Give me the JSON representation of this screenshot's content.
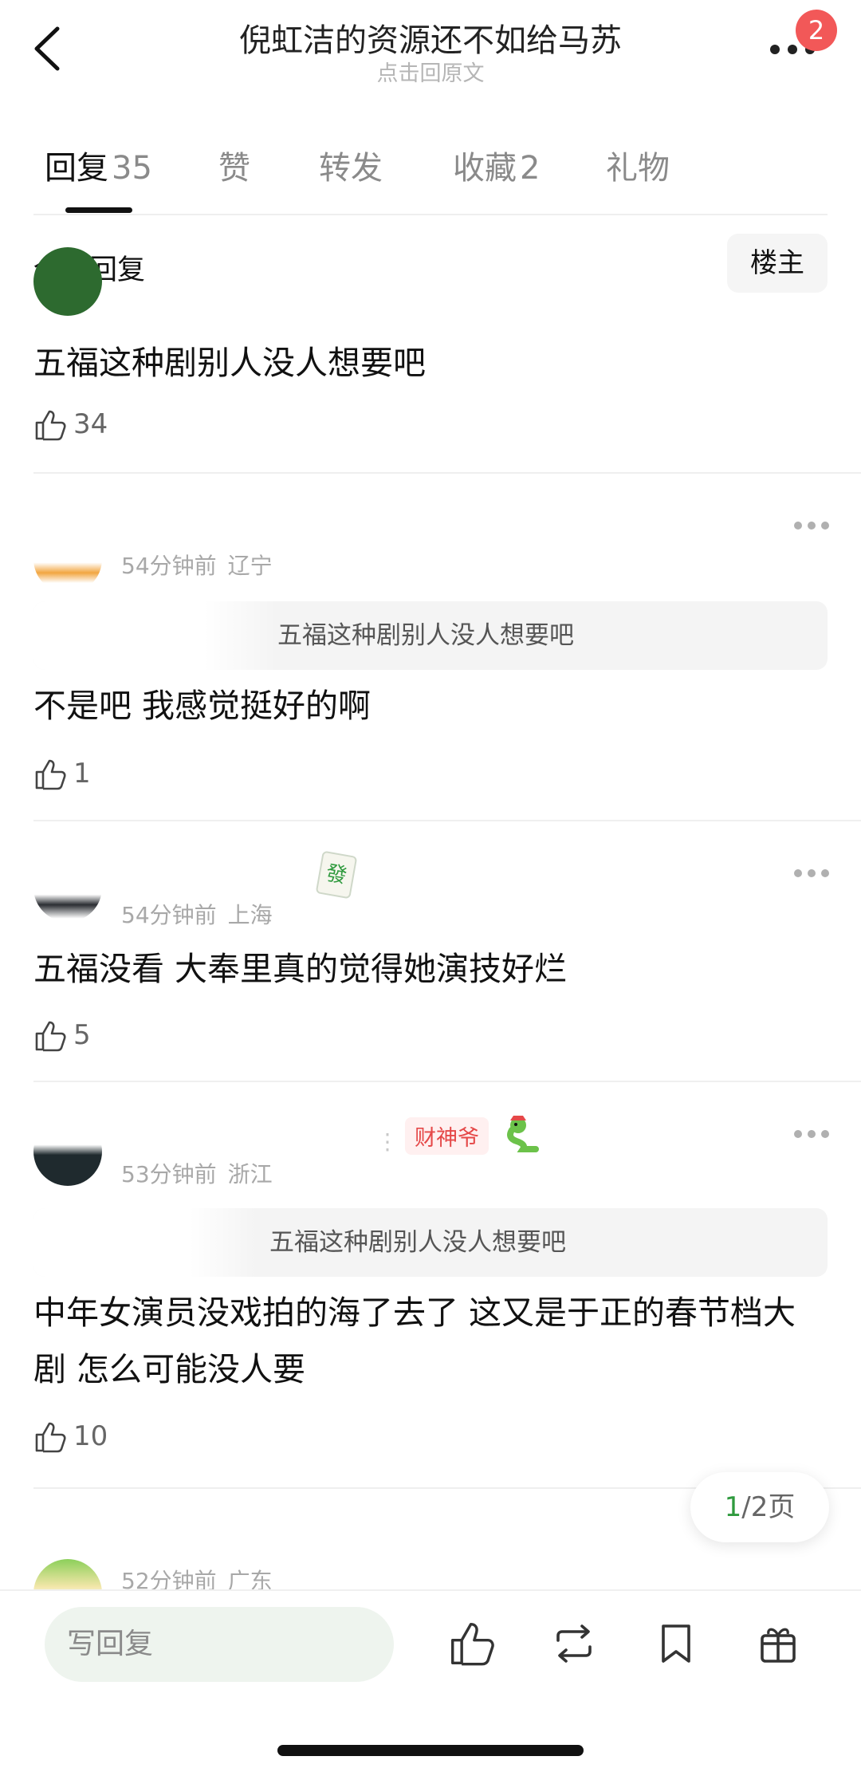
{
  "header": {
    "title": "倪虹洁的资源还不如给马苏",
    "subtitle": "点击回原文",
    "badge": "2",
    "back_icon": "chevron-left-icon",
    "more_icon": "more-dots-icon"
  },
  "tabs": [
    {
      "label": "回复",
      "count": "35"
    },
    {
      "label": "赞",
      "count": ""
    },
    {
      "label": "转发",
      "count": ""
    },
    {
      "label": "收藏",
      "count": "2"
    },
    {
      "label": "礼物",
      "count": ""
    }
  ],
  "filter": {
    "title": "全部回复",
    "owner_button": "楼主"
  },
  "comments": [
    {
      "content": "五福这种剧别人没人想要吧",
      "likes": "34"
    },
    {
      "time": "54分钟前",
      "location": "辽宁",
      "quote": "五福这种剧别人没人想要吧",
      "content": "不是吧 我感觉挺好的啊",
      "likes": "1"
    },
    {
      "time": "54分钟前",
      "location": "上海",
      "content": "五福没看 大奉里真的觉得她演技好烂",
      "likes": "5"
    },
    {
      "time": "53分钟前",
      "location": "浙江",
      "tag": "财神爷",
      "quote": "五福这种剧别人没人想要吧",
      "content": "中年女演员没戏拍的海了去了 这又是于正的春节档大剧 怎么可能没人要",
      "likes": "10"
    },
    {
      "time": "52分钟前",
      "location": "广东"
    }
  ],
  "pagination": {
    "current": "1",
    "rest": "/2页"
  },
  "bottom_bar": {
    "reply_placeholder": "写回复",
    "icons": [
      "thumbs-up-icon",
      "repost-icon",
      "bookmark-icon",
      "gift-icon"
    ]
  },
  "colors": {
    "accent_green": "#2f9a3e",
    "badge_red": "#f25858",
    "tag_red": "#e54848"
  }
}
